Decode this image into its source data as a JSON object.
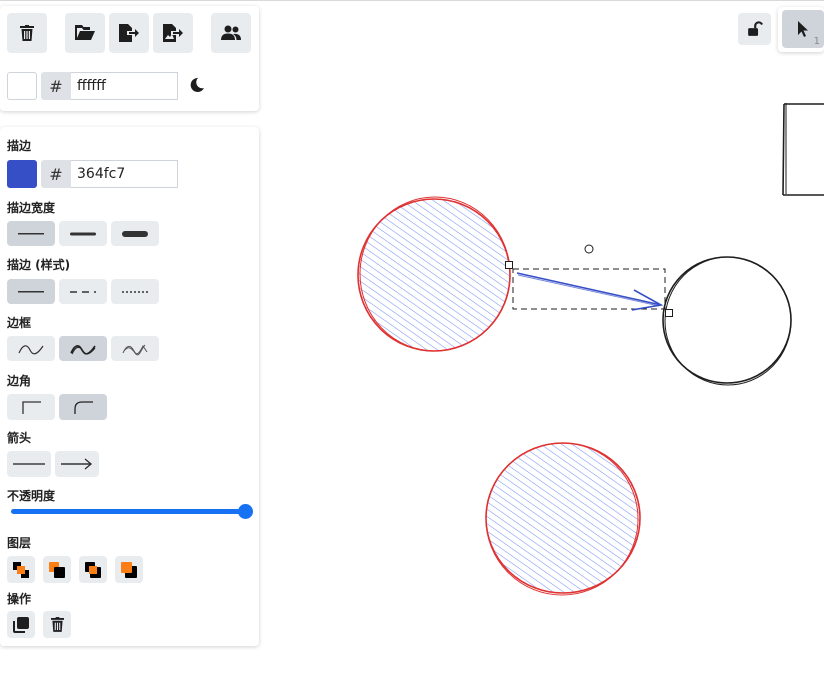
{
  "toolbar": {
    "lock_icon": "lock-open-icon",
    "select_icon": "pointer-icon",
    "select_shortcut": "1"
  },
  "file_menu": {
    "icons": [
      "trash-icon",
      "folder-open-icon",
      "export-icon",
      "export-image-icon",
      "collaborate-icon"
    ]
  },
  "background": {
    "hash": "#",
    "value": "ffffff",
    "color": "#ffffff",
    "theme_icon": "moon-icon"
  },
  "properties": {
    "stroke_label": "描边",
    "stroke_hash": "#",
    "stroke_value": "364fc7",
    "stroke_color": "#364fc7",
    "stroke_width_label": "描边宽度",
    "stroke_style_label": "描边 (样式)",
    "sloppiness_label": "边框",
    "edges_label": "边角",
    "arrowheads_label": "箭头",
    "opacity_label": "不透明度",
    "opacity_value": 1.0,
    "layers_label": "图层",
    "actions_label": "操作"
  },
  "colors": {
    "accent": "#1672f3",
    "circle_stroke": "#e03131",
    "circle_fill": "#4c6ef5",
    "arrow": "#364fc7",
    "layer_orange": "#fd7e14"
  }
}
